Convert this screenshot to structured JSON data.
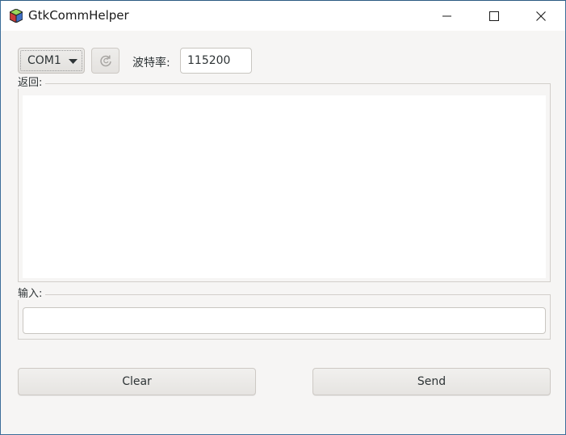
{
  "window": {
    "title": "GtkCommHelper",
    "icon": "gtk-cube-icon",
    "controls": {
      "minimize": "minimize-icon",
      "maximize": "maximize-icon",
      "close": "close-icon"
    }
  },
  "toolbar": {
    "port_selected": "COM1",
    "refresh_icon": "refresh-icon",
    "baud_label": "波特率:",
    "baud_value": "115200"
  },
  "return_section": {
    "label": "返回:",
    "content": ""
  },
  "input_section": {
    "label": "输入:",
    "value": ""
  },
  "buttons": {
    "clear": "Clear",
    "send": "Send"
  },
  "colors": {
    "window_bg": "#f6f5f4",
    "titlebar_bg": "#ffffff",
    "border_accent": "#3c6e9a"
  }
}
